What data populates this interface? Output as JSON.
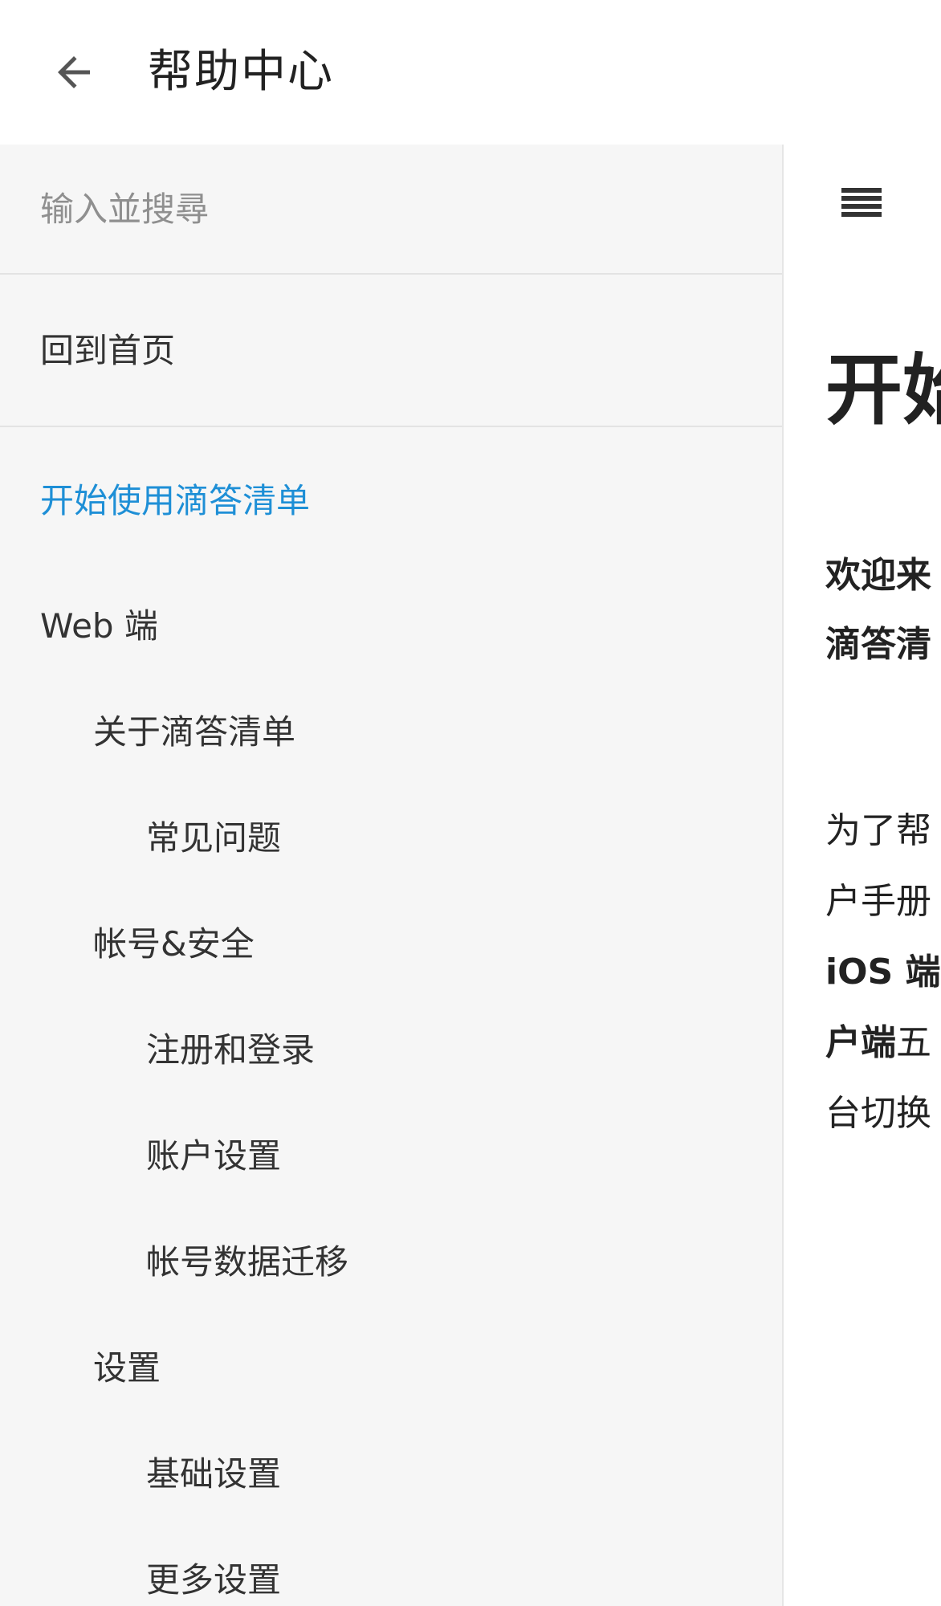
{
  "app": {
    "title": "帮助中心",
    "back_icon": "arrow-left-icon",
    "menu_icon": "menu-icon"
  },
  "sidebar": {
    "search": {
      "placeholder": "输入並搜尋"
    },
    "home_label": "回到首页",
    "items": [
      {
        "label": "开始使用滴答清单",
        "level": 0,
        "active": true
      },
      {
        "label": "Web 端",
        "level": 0,
        "active": false
      },
      {
        "label": "关于滴答清单",
        "level": 1,
        "active": false
      },
      {
        "label": "常见问题",
        "level": 2,
        "active": false
      },
      {
        "label": "帐号&安全",
        "level": 1,
        "active": false
      },
      {
        "label": "注册和登录",
        "level": 2,
        "active": false
      },
      {
        "label": "账户设置",
        "level": 2,
        "active": false
      },
      {
        "label": "帐号数据迁移",
        "level": 2,
        "active": false
      },
      {
        "label": "设置",
        "level": 1,
        "active": false
      },
      {
        "label": "基础设置",
        "level": 2,
        "active": false
      },
      {
        "label": "更多设置",
        "level": 2,
        "active": false
      }
    ],
    "active_color": "#1e8fd6"
  },
  "content": {
    "title": "开始",
    "intro_line1": "欢迎来",
    "intro_line2": "滴答清",
    "para_line1": "为了帮",
    "para_line2": "户手册",
    "para_line3": "iOS 端",
    "para_line4_bold": "户端",
    "para_line4_rest": "五",
    "para_line5": "台切换"
  }
}
